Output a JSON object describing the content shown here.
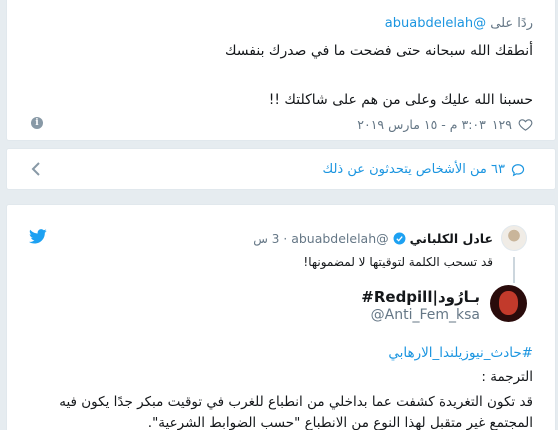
{
  "reply_tweet": {
    "reply_prefix": "ردًا على",
    "reply_handle": "@abuabdelelah",
    "line1": "أنطقك الله سبحانه حتى فضحت ما في صدرك بنفسك",
    "line2": "حسبنا الله عليك وعلى من هم على شاكلتك !!",
    "likes": "١٢٩",
    "timestamp": "٣:٠٣ م - ١٥ مارس ٢٠١٩"
  },
  "more_people": {
    "label": "٦٣ من الأشخاص يتحدثون عن ذلك"
  },
  "embedded": {
    "quoted": {
      "name": "عادل الكلباني",
      "handle": "@abuabdelelah",
      "dot": "·",
      "time": "3 س",
      "text": "قد تسحب الكلمة لتوقيتها لا لمضمونها!"
    },
    "author": {
      "name": "بـارُود|Redpill#",
      "handle": "@Anti_Fem_ksa"
    },
    "hashtag": "#حادث_نيوزيلندا_الارهابي",
    "translation_label": "الترجمة :",
    "body_line1": "قد تكون التغريدة كشفت عما بداخلي من انطباع للغرب في توقيت مبكر جدًا يكون فيه",
    "body_line2": "المجتمع غير متقبل لهذا النوع من الانطباع \"حسب الضوابط الشرعية\"."
  },
  "colors": {
    "link": "#1b95e0",
    "muted": "#657786",
    "background": "#e6ecf0",
    "verified": "#1da1f2"
  },
  "icons": {
    "like": "heart-outline-icon",
    "info": "info-icon",
    "comment": "speech-bubble-icon",
    "chevron": "chevron-left-icon",
    "twitter": "twitter-bird-icon",
    "verified": "verified-badge-icon"
  }
}
